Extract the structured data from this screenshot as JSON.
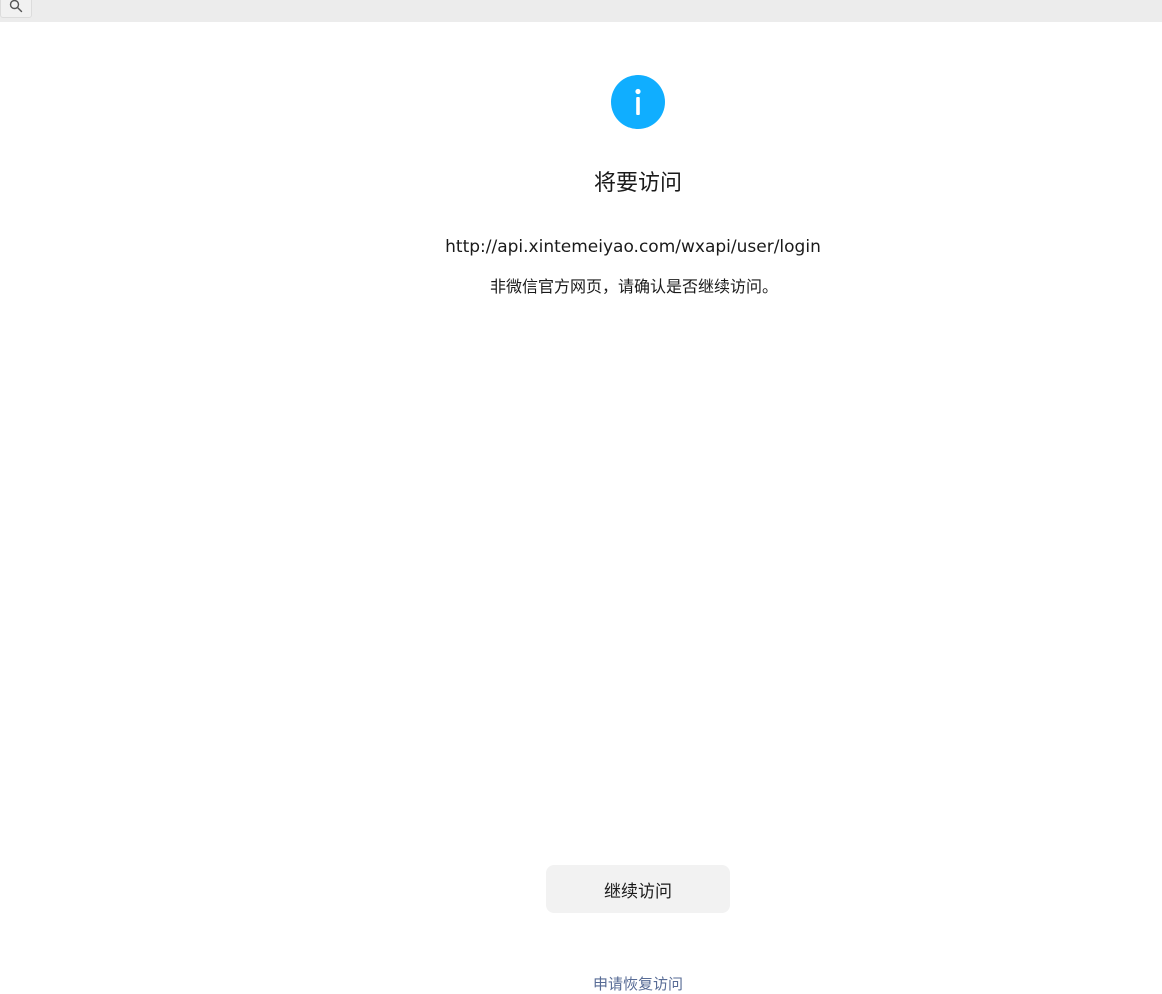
{
  "header": {
    "search_icon": "search-icon"
  },
  "dialog": {
    "icon": "info-icon",
    "icon_color": "#10aeff",
    "title": "将要访问",
    "url": "http://api.xintemeiyao.com/wxapi/user/login",
    "notice": "非微信官方网页，请确认是否继续访问。",
    "continue_label": "继续访问",
    "report_label": "申请恢复访问"
  }
}
